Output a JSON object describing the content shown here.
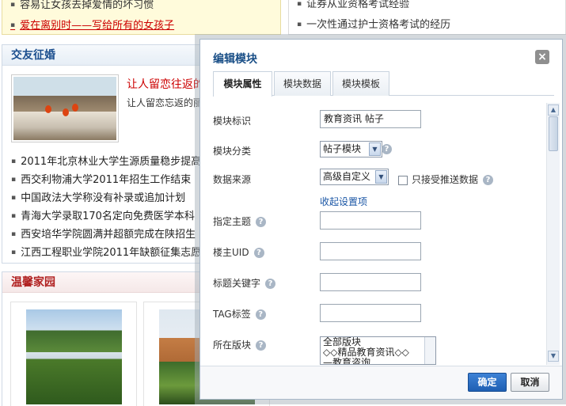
{
  "background": {
    "top_left_items": [
      "容易让女孩去掉爱情的坏习惯",
      "爱在离别时——写给所有的女孩子"
    ],
    "top_right_items": [
      "证券从业资格考试经验",
      "一次性通过护士资格考试的经历"
    ],
    "friends_panel": {
      "title": "交友征婚",
      "feature_title": "让人留恋往返的",
      "feature_desc": "让人留恋忘返的丽"
    },
    "news_items": [
      "2011年北京林业大学生源质量稳步提高",
      "西交利物浦大学2011年招生工作结束",
      "中国政法大学称没有补录或追加计划",
      "青海大学录取170名定向免费医学本科",
      "西安培华学院圆满并超额完成在陕招生",
      "江西工程职业学院2011年缺额征集志愿"
    ],
    "home_panel": {
      "title": "温馨家园"
    }
  },
  "dialog": {
    "title": "编辑模块",
    "close_symbol": "×",
    "tabs": [
      {
        "label": "模块属性",
        "active": true
      },
      {
        "label": "模块数据",
        "active": false
      },
      {
        "label": "模块模板",
        "active": false
      }
    ],
    "fields": {
      "module_id": {
        "label": "模块标识",
        "value": "教育资讯 帖子"
      },
      "module_category": {
        "label": "模块分类",
        "value": "帖子模块"
      },
      "data_source": {
        "label": "数据来源",
        "value": "高级自定义",
        "checkbox_label": "只接受推送数据"
      },
      "collapse_link": "收起设置项",
      "topic": {
        "label": "指定主题",
        "value": ""
      },
      "owner_uid": {
        "label": "楼主UID",
        "value": ""
      },
      "title_keyword": {
        "label": "标题关键字",
        "value": ""
      },
      "tag": {
        "label": "TAG标签",
        "value": ""
      },
      "forum": {
        "label": "所在版块",
        "options": [
          "全部版块",
          "◇◇精品教育资讯◇◇",
          "—教育咨询"
        ]
      }
    },
    "help_symbol": "?",
    "buttons": {
      "ok": "确定",
      "cancel": "取消"
    }
  },
  "icons": {
    "close": "close-icon",
    "help": "help-icon",
    "dropdown": "chevron-down-icon",
    "scroll_up": "arrow-up-icon",
    "scroll_down": "arrow-down-icon"
  }
}
